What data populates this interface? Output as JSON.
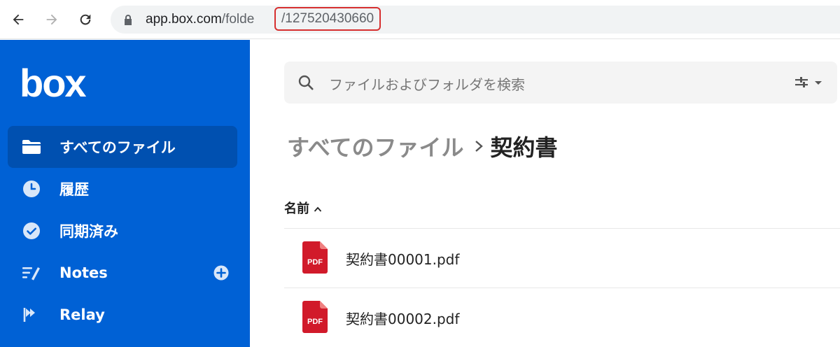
{
  "browser": {
    "url_host": "app.box.com",
    "url_path": "/folde",
    "url_folder_id": "/127520430660"
  },
  "sidebar": {
    "logo": "box",
    "items": [
      {
        "label": "すべてのファイル",
        "icon": "folder-icon",
        "active": true
      },
      {
        "label": "履歴",
        "icon": "clock-icon"
      },
      {
        "label": "同期済み",
        "icon": "check-circle-icon"
      },
      {
        "label": "Notes",
        "icon": "notes-icon"
      },
      {
        "label": "Relay",
        "icon": "relay-icon"
      }
    ]
  },
  "search": {
    "placeholder": "ファイルおよびフォルダを検索"
  },
  "breadcrumb": {
    "root": "すべてのファイル",
    "current": "契約書"
  },
  "list": {
    "column_name": "名前",
    "files": [
      {
        "name": "契約書00001.pdf",
        "type": "PDF"
      },
      {
        "name": "契約書00002.pdf",
        "type": "PDF"
      }
    ]
  },
  "colors": {
    "sidebar": "#0061d5",
    "sidebar_active": "#0050b0",
    "highlight": "#d62f2f",
    "pdf": "#d11a2a"
  }
}
